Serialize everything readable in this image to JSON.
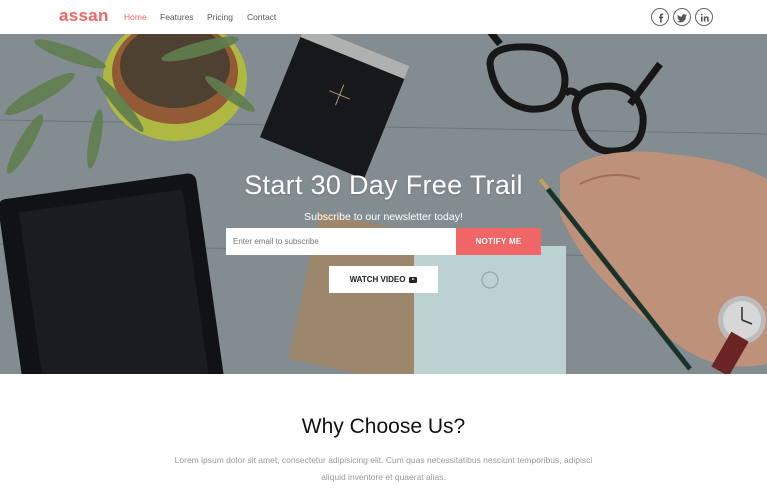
{
  "brand": {
    "logo": "assan",
    "accent": "#f06565"
  },
  "nav": {
    "items": [
      {
        "label": "Home",
        "active": true
      },
      {
        "label": "Features",
        "active": false
      },
      {
        "label": "Pricing",
        "active": false
      },
      {
        "label": "Contact",
        "active": false
      }
    ],
    "social": [
      {
        "icon": "facebook-icon",
        "glyph": "f"
      },
      {
        "icon": "twitter-icon",
        "glyph": "t"
      },
      {
        "icon": "linkedin-icon",
        "glyph": "in"
      }
    ]
  },
  "hero": {
    "title": "Start 30 Day Free Trail",
    "subtitle": "Subscribe to our newsletter today!",
    "email_placeholder": "Enter email to subscribe",
    "email_value": "",
    "notify_label": "NOTIFY ME",
    "watch_label": "WATCH VIDEO"
  },
  "features": {
    "title": "Why Choose Us?",
    "text": "Lorem ipsum dolor sit amet, consectetur adipisicing elit. Cum quas necessitatibus nesciunt temporibus, adipisci aliquid inventore et quaerat alias."
  }
}
